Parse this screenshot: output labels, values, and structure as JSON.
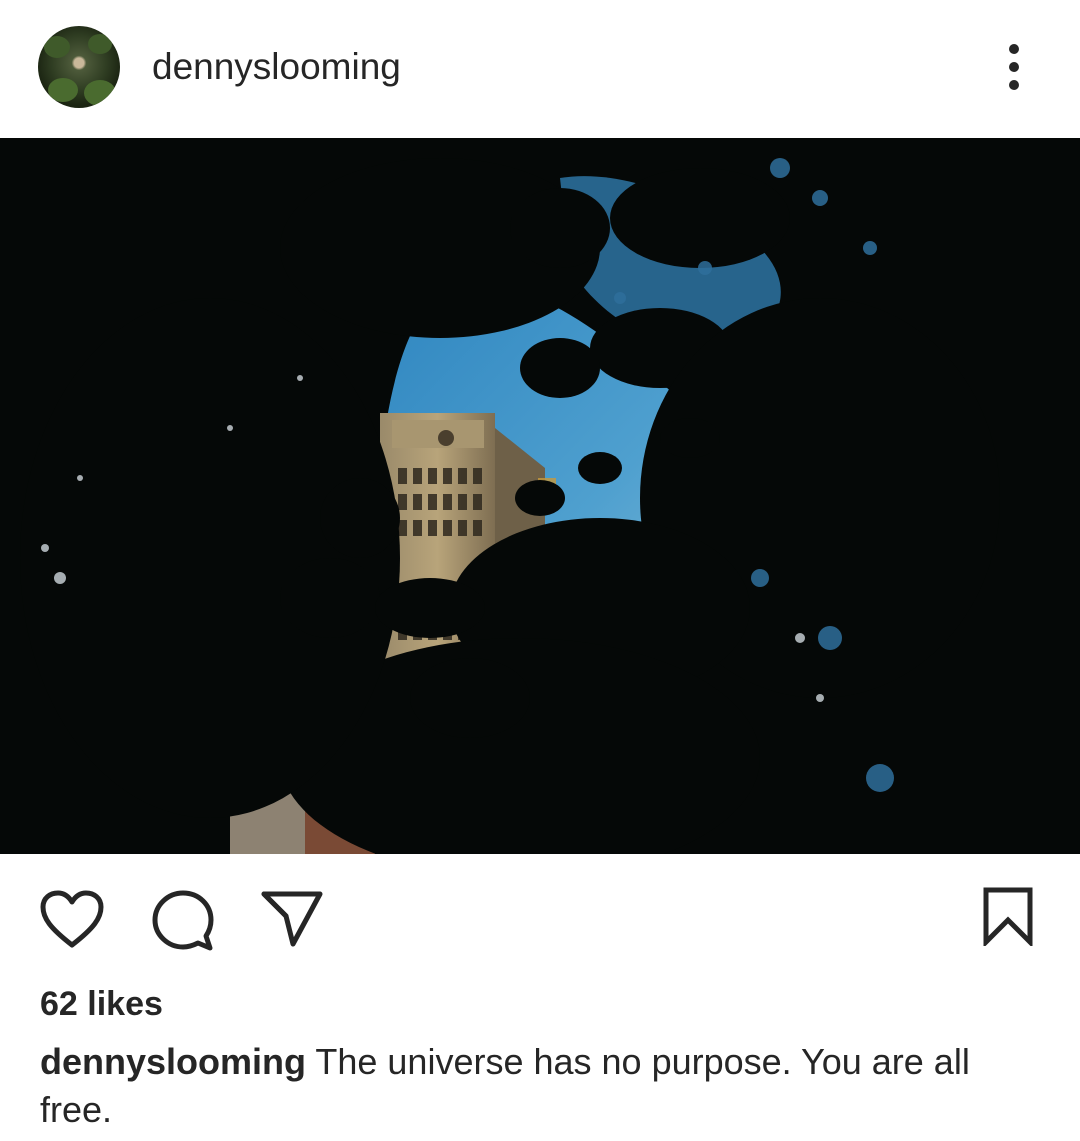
{
  "post": {
    "username": "dennyslooming",
    "likes": "62 likes",
    "caption_user": "dennyslooming",
    "caption_text": "The universe has no purpose. You are all free."
  },
  "icons": {
    "more": "more-vertical-icon",
    "like": "heart-icon",
    "comment": "comment-icon",
    "share": "send-icon",
    "save": "bookmark-icon"
  },
  "colors": {
    "text": "#262626",
    "background": "#ffffff",
    "sky": "#3d8fc2",
    "foliage": "#050807"
  }
}
